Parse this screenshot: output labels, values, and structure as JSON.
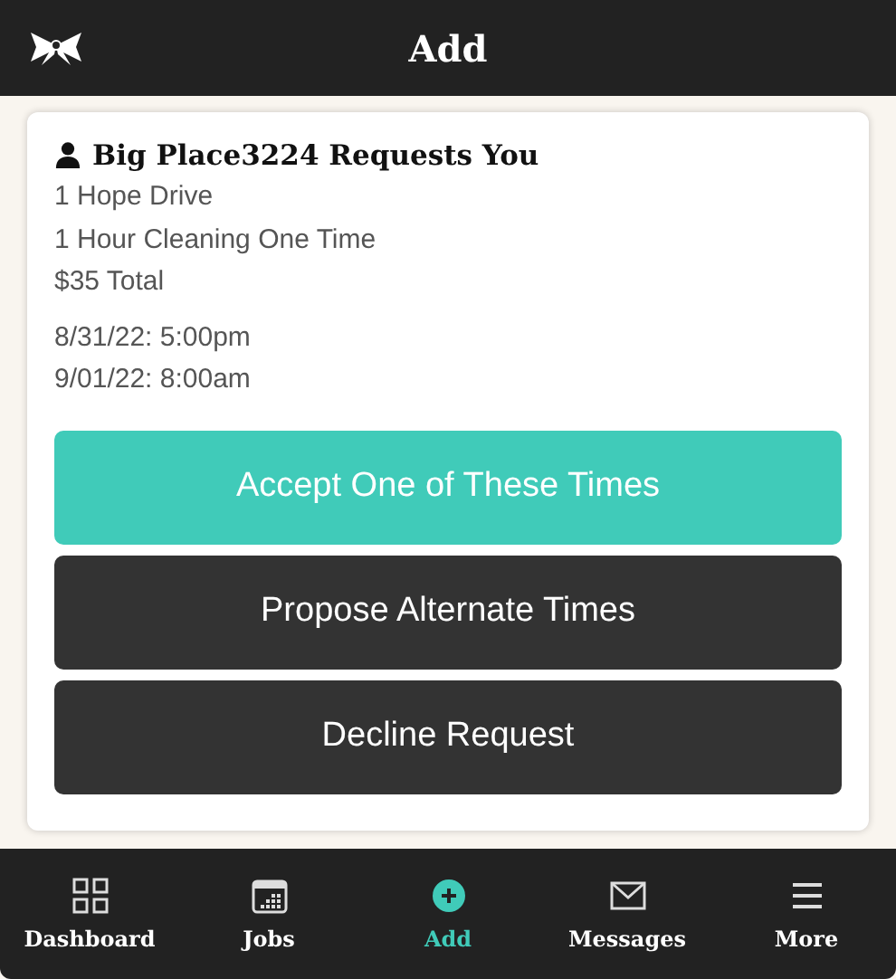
{
  "header": {
    "title": "Add"
  },
  "request": {
    "title": "Big Place3224 Requests You",
    "details": [
      "1 Hope Drive",
      "1 Hour Cleaning One Time",
      "$35 Total"
    ],
    "times": [
      "8/31/22: 5:00pm",
      "9/01/22: 8:00am"
    ],
    "actions": [
      {
        "label": "Accept One of These Times",
        "kind": "primary"
      },
      {
        "label": "Propose Alternate Times",
        "kind": "secondary"
      },
      {
        "label": "Decline Request",
        "kind": "secondary"
      }
    ]
  },
  "nav": [
    {
      "label": "Dashboard",
      "kind": "grid",
      "selected": false
    },
    {
      "label": "Jobs",
      "kind": "calendar",
      "selected": false
    },
    {
      "label": "Add",
      "kind": "add",
      "selected": true
    },
    {
      "label": "Messages",
      "kind": "mail",
      "selected": false
    },
    {
      "label": "More",
      "kind": "menu",
      "selected": false
    }
  ]
}
